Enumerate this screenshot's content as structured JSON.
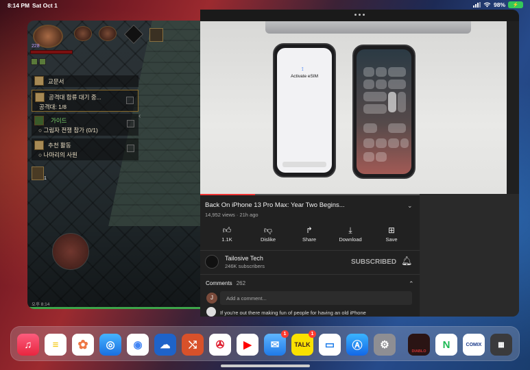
{
  "status_bar": {
    "time": "8:14 PM",
    "date": "Sat Oct 1",
    "battery": "98%"
  },
  "game": {
    "level": "228",
    "quest_header": "교문서",
    "quest1_title": "공격대 합류 대기 중...",
    "quest1_sub": "공격대: 1/8",
    "guide_title": "가이드",
    "guide_sub": "그림자 전쟁 참가 (0/1)",
    "rec_title": "추천 활동",
    "rec_sub": "나마리의 사원",
    "inv_count": "1",
    "clock": "오후 8:14"
  },
  "youtube": {
    "video_title": "Back On iPhone 13 Pro Max: Year Two Begins...",
    "video_meta": "14,952 views · 21h ago",
    "activate_esim": "Activate eSIM",
    "actions": {
      "like": "1.1K",
      "dislike": "Dislike",
      "share": "Share",
      "download": "Download",
      "save": "Save"
    },
    "channel_name": "Tailosive Tech",
    "channel_subs": "246K subscribers",
    "subscribed_label": "SUBSCRIBED",
    "comments_label": "Comments",
    "comments_count": "262",
    "user_initial": "J",
    "add_comment_placeholder": "Add a comment...",
    "top_comment": "If you're out there making fun of people for having an old iPhone"
  },
  "dock": {
    "mail_badge": "1",
    "talk_badge": "1",
    "talk_label": "TALK",
    "diablo_label": "DIABLO",
    "comix_label": "COMIX"
  }
}
